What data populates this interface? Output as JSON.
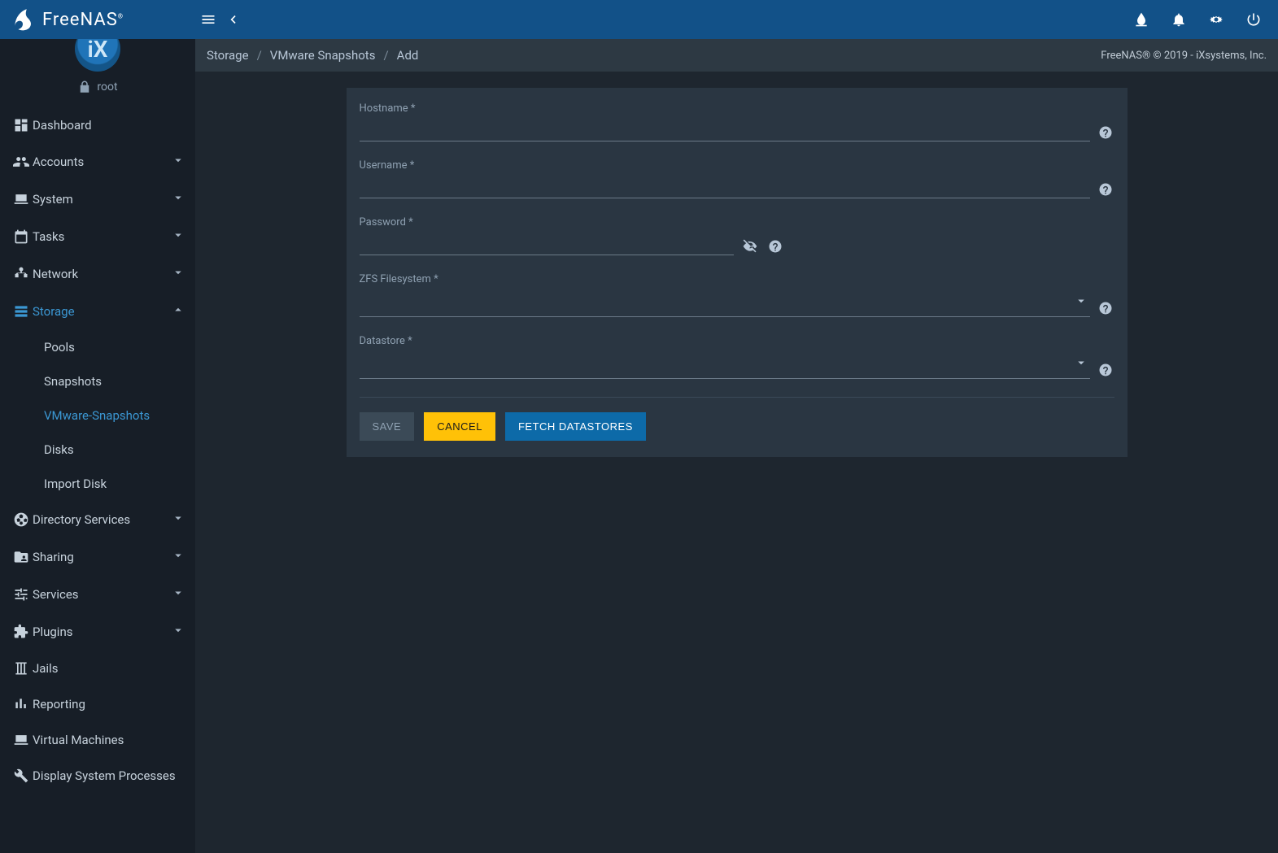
{
  "brand": {
    "name": "FreeNAS",
    "user": "root",
    "avatar_text": "iX"
  },
  "topbar": {
    "menu_icon": "menu",
    "back_icon": "chevron-left"
  },
  "breadcrumb": {
    "items": [
      "Storage",
      "VMware Snapshots",
      "Add"
    ],
    "sep": "/"
  },
  "copyright": "FreeNAS® © 2019 - iXsystems, Inc.",
  "sidebar": {
    "items": [
      {
        "label": "Dashboard",
        "icon": "dashboard",
        "expandable": false
      },
      {
        "label": "Accounts",
        "icon": "people",
        "expandable": true
      },
      {
        "label": "System",
        "icon": "laptop",
        "expandable": true
      },
      {
        "label": "Tasks",
        "icon": "calendar",
        "expandable": true
      },
      {
        "label": "Network",
        "icon": "network",
        "expandable": true
      },
      {
        "label": "Storage",
        "icon": "storage",
        "expandable": true,
        "active": true,
        "children": [
          {
            "label": "Pools"
          },
          {
            "label": "Snapshots"
          },
          {
            "label": "VMware-Snapshots",
            "active": true
          },
          {
            "label": "Disks"
          },
          {
            "label": "Import Disk"
          }
        ]
      },
      {
        "label": "Directory Services",
        "icon": "sports-soccer",
        "expandable": true
      },
      {
        "label": "Sharing",
        "icon": "folder-shared",
        "expandable": true
      },
      {
        "label": "Services",
        "icon": "tune",
        "expandable": true
      },
      {
        "label": "Plugins",
        "icon": "extension",
        "expandable": true
      },
      {
        "label": "Jails",
        "icon": "jail",
        "expandable": false
      },
      {
        "label": "Reporting",
        "icon": "bar-chart",
        "expandable": false
      },
      {
        "label": "Virtual Machines",
        "icon": "laptop",
        "expandable": false
      },
      {
        "label": "Display System Processes",
        "icon": "build",
        "expandable": false
      }
    ]
  },
  "form": {
    "hostname": {
      "label": "Hostname *",
      "value": ""
    },
    "username": {
      "label": "Username *",
      "value": ""
    },
    "password": {
      "label": "Password *",
      "value": ""
    },
    "zfs": {
      "label": "ZFS Filesystem *",
      "value": ""
    },
    "datastore": {
      "label": "Datastore *",
      "value": ""
    },
    "buttons": {
      "save": "SAVE",
      "cancel": "CANCEL",
      "fetch": "FETCH DATASTORES"
    }
  }
}
